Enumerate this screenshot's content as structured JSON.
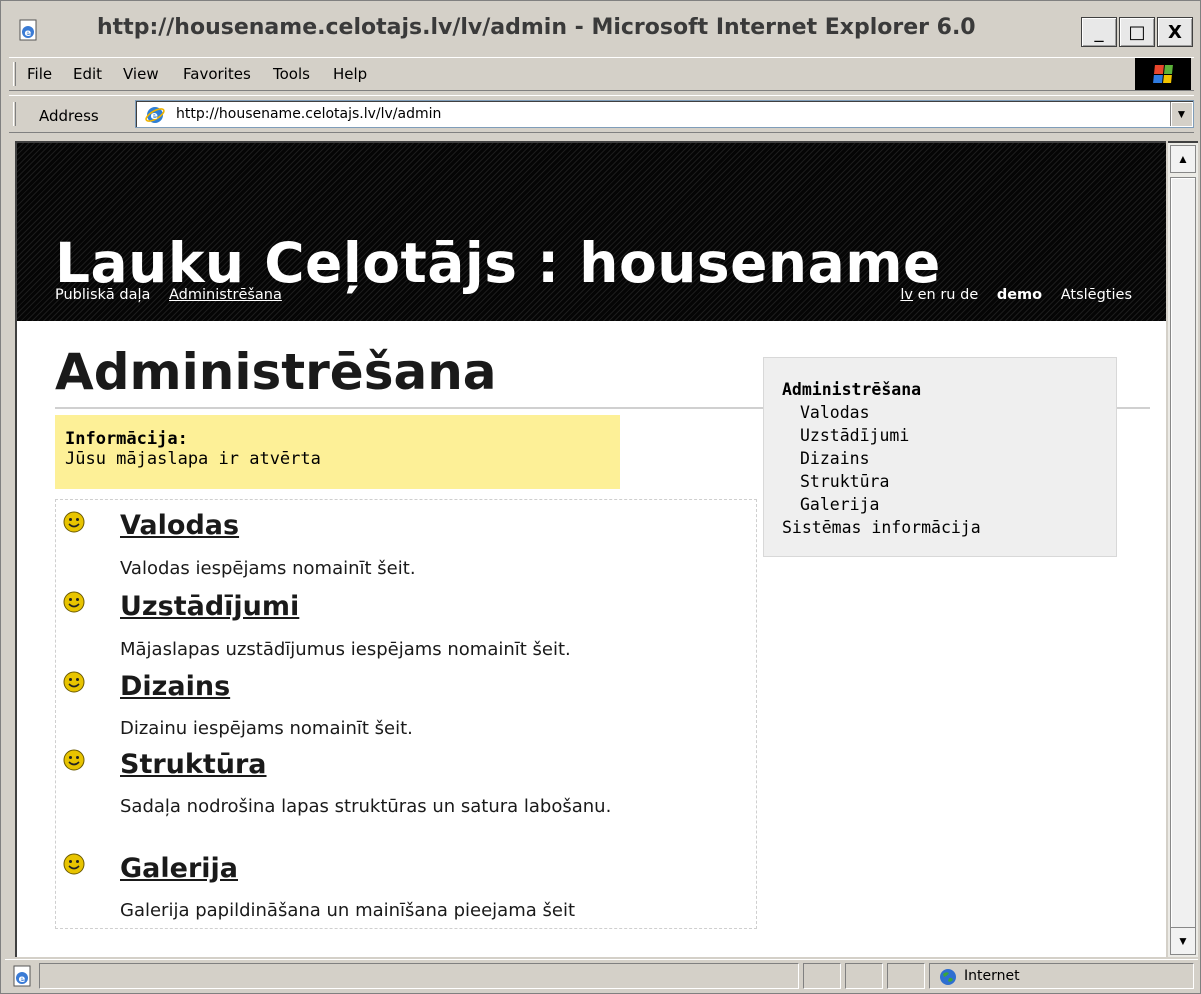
{
  "window": {
    "title": "http://housename.celotajs.lv/lv/admin - Microsoft Internet Explorer 6.0",
    "min_label": "_",
    "max_label": "□",
    "close_label": "X"
  },
  "menu": {
    "items": [
      "File",
      "Edit",
      "View",
      "Favorites",
      "Tools",
      "Help"
    ]
  },
  "address": {
    "label": "Address",
    "url": "http://housename.celotajs.lv/lv/admin"
  },
  "site": {
    "title": "Lauku Ceļotājs : housename",
    "nav": [
      "Publiskā daļa",
      "Administrēšana"
    ],
    "nav_active_index": 1,
    "languages": [
      "lv",
      "en",
      "ru",
      "de"
    ],
    "current_language": "lv",
    "user": "demo",
    "logout": "Atslēgties"
  },
  "page": {
    "title": "Administrēšana",
    "info_heading": "Informācija:",
    "info_text": "Jūsu mājaslapa ir atvērta",
    "sections": [
      {
        "title": "Valodas",
        "desc": "Valodas iespējams nomainīt šeit."
      },
      {
        "title": "Uzstādījumi",
        "desc": "Mājaslapas uzstādījumus iespējams nomainīt šeit."
      },
      {
        "title": "Dizains",
        "desc": "Dizainu iespējams nomainīt šeit."
      },
      {
        "title": "Struktūra",
        "desc": "Sadaļa nodrošina lapas struktūras un satura labošanu."
      },
      {
        "title": "Galerija",
        "desc": "Galerija papildināšana un mainīšana pieejama šeit"
      }
    ]
  },
  "sidebar": {
    "heading": "Administrēšana",
    "items": [
      "Valodas",
      "Uzstādījumi",
      "Dizains",
      "Struktūra",
      "Galerija"
    ],
    "footer": "Sistēmas informācija"
  },
  "status": {
    "zone": "Internet"
  },
  "colors": {
    "info_bg": "#fdf097",
    "banner_bg": "#0a0a0a",
    "sidebar_bg": "#efefef"
  }
}
